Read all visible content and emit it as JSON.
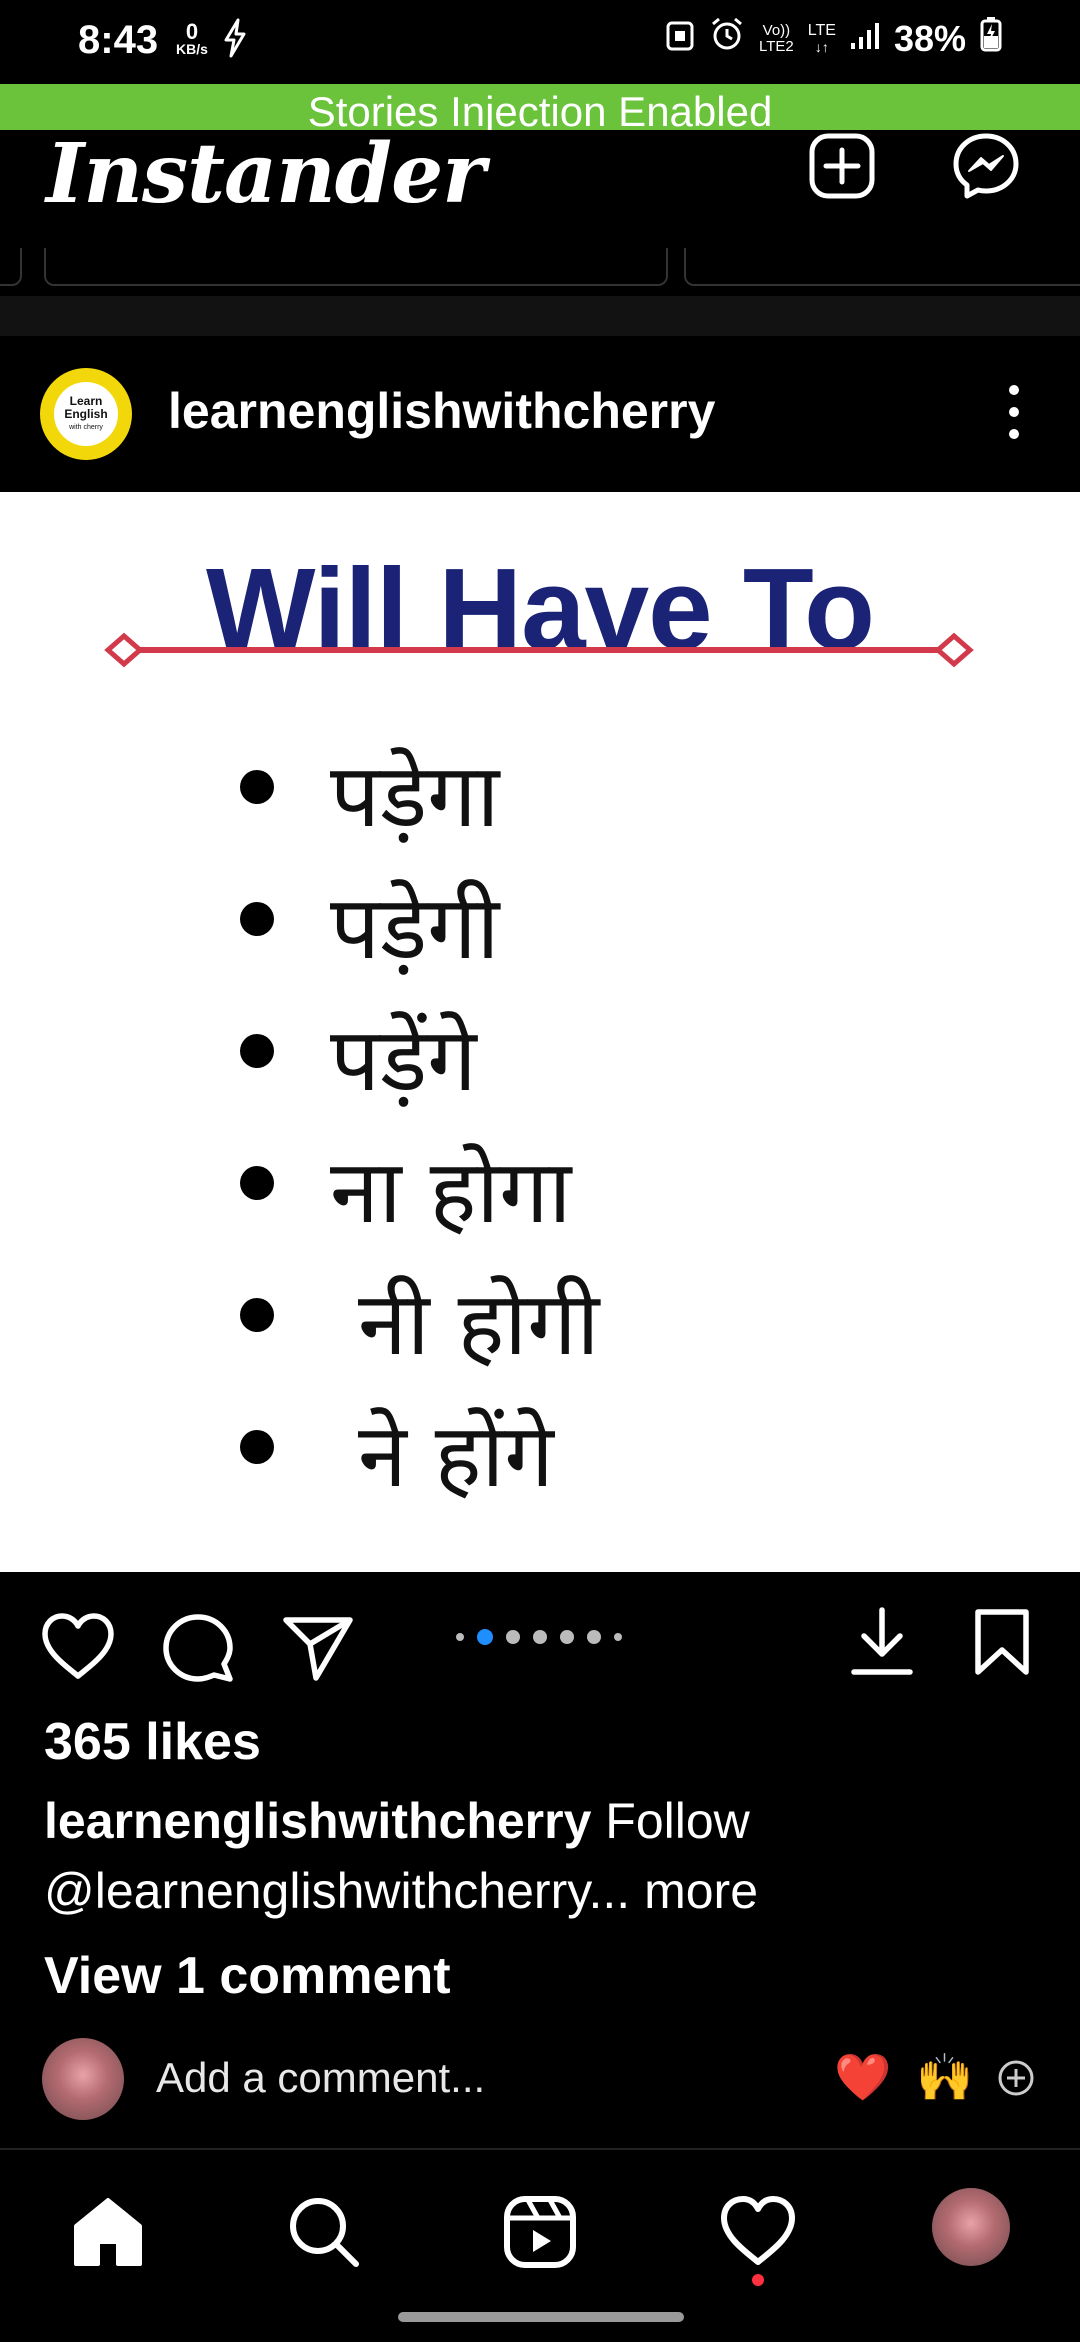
{
  "status_bar": {
    "time": "8:43",
    "net_speed_value": "0",
    "net_speed_unit": "KB/s",
    "network_label_top": "Vo))",
    "network_label_bottom": "LTE2",
    "lte_label": "LTE",
    "battery": "38%",
    "icons": [
      "charging-bolt-icon",
      "lock-badge-icon",
      "alarm-icon",
      "signal-icon",
      "battery-charging-icon"
    ]
  },
  "banner": {
    "text": "Stories Injection Enabled",
    "color": "#6ac33b"
  },
  "header": {
    "app_name": "Instander",
    "new_post_icon": "plus-square-icon",
    "messenger_icon": "messenger-icon"
  },
  "post": {
    "avatar_text": [
      "Learn",
      "English",
      "with cherry"
    ],
    "username": "learnenglishwithcherry",
    "image": {
      "title": "Will Have To",
      "title_color": "#1b2377",
      "rule_color": "#d23a4c",
      "items": [
        "पड़ेगा",
        "पड़ेगी",
        "पड़ेंगे",
        "ना होगा",
        " नी होगी",
        " ने होंगे"
      ]
    },
    "carousel": {
      "count": 7,
      "active_index": 1
    },
    "likes": "365 likes",
    "caption_user": "learnenglishwithcherry",
    "caption_text": " Follow",
    "caption_line2": "@learnenglishwithcherry...",
    "caption_more": " more",
    "view_comments": "View 1 comment",
    "comment_placeholder": "Add a comment...",
    "quick_reactions": [
      "❤️",
      "🙌"
    ]
  },
  "bottom_nav": {
    "items": [
      "home-icon",
      "search-icon",
      "reels-icon",
      "activity-heart-icon",
      "profile-avatar"
    ],
    "accent": "#ff3040"
  }
}
